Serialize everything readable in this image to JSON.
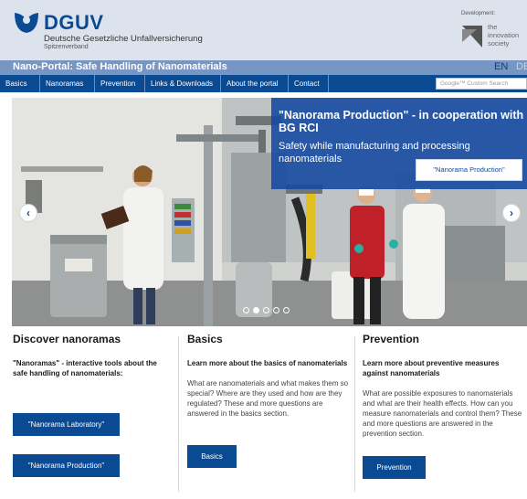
{
  "header": {
    "logo_title": "DGUV",
    "logo_subtitle": "Deutsche Gesetzliche Unfallversicherung",
    "logo_subtitle2": "Spitzenverband",
    "development_label": "Development:",
    "innovation_text": "the innovation society"
  },
  "titlebar": {
    "portal_title": "Nano-Portal: Safe Handling of Nanomaterials",
    "lang_en": "EN",
    "lang_de": "DE"
  },
  "nav": {
    "items": [
      "Basics",
      "Nanoramas",
      "Prevention",
      "Links & Downloads",
      "About the portal",
      "Contact"
    ],
    "search_placeholder": "Google™ Custom Search"
  },
  "hero": {
    "title": "\"Nanorama Production\" - in cooperation with BG RCI",
    "subtitle": "Safety while manufacturing and processing nanomaterials",
    "button_label": "\"Nanorama Production\"",
    "prev_label": "‹",
    "next_label": "›",
    "slide_count": 5,
    "active_slide": 1
  },
  "columns": {
    "discover": {
      "title": "Discover nanoramas",
      "lead": "\"Nanoramas\" - interactive tools about the safe handling of nanomaterials:",
      "btn_lab": "\"Nanorama Laboratory\"",
      "btn_prod": "\"Nanorama Production\""
    },
    "basics": {
      "title": "Basics",
      "lead": "Learn more about the basics of nanomaterials",
      "text": "What are nanomaterials and what makes them so special? Where are they used and how are they regulated? These and more questions are answered in the basics section.",
      "button": "Basics"
    },
    "prevention": {
      "title": "Prevention",
      "lead": "Learn more about preventive measures against nanomaterials",
      "text": "What are possible exposures to nanomaterials and what are their health effects. How can you measure nanomaterials and control them? These and more questions are answered in the prevention section.",
      "button": "Prevention"
    }
  },
  "colors": {
    "brand_blue": "#0a4a93",
    "title_bar": "#7796c4",
    "header_bg": "#dde3ec",
    "overlay": "#1248a0"
  }
}
